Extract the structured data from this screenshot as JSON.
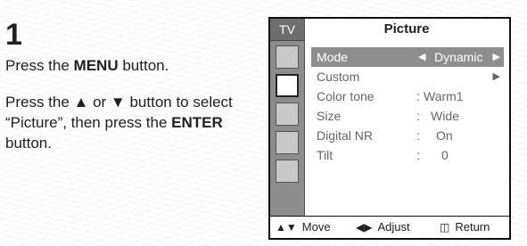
{
  "step": {
    "number": "1",
    "para1": {
      "pre": "Press the ",
      "bold": "MENU",
      "post": " button."
    },
    "para2": {
      "pre": "Press the ▲ or ▼ button to select “Picture”, then press the ",
      "bold": "ENTER",
      "post": " button."
    }
  },
  "osd": {
    "tab_label": "TV",
    "title": "Picture",
    "menu": [
      {
        "label": "Mode",
        "value": "Dynamic",
        "highlight": true
      },
      {
        "label": "Custom",
        "value": "",
        "submenu": true
      },
      {
        "label": "Color tone",
        "value": "Warm1"
      },
      {
        "label": "Size",
        "value": "Wide"
      },
      {
        "label": "Digital NR",
        "value": "On"
      },
      {
        "label": "Tilt",
        "value": "0"
      }
    ],
    "footer": {
      "move": "Move",
      "adjust": "Adjust",
      "return": "Return"
    },
    "side_icons": [
      "input-icon",
      "picture-icon",
      "sound-icon",
      "channel-icon",
      "setup-icon"
    ]
  }
}
